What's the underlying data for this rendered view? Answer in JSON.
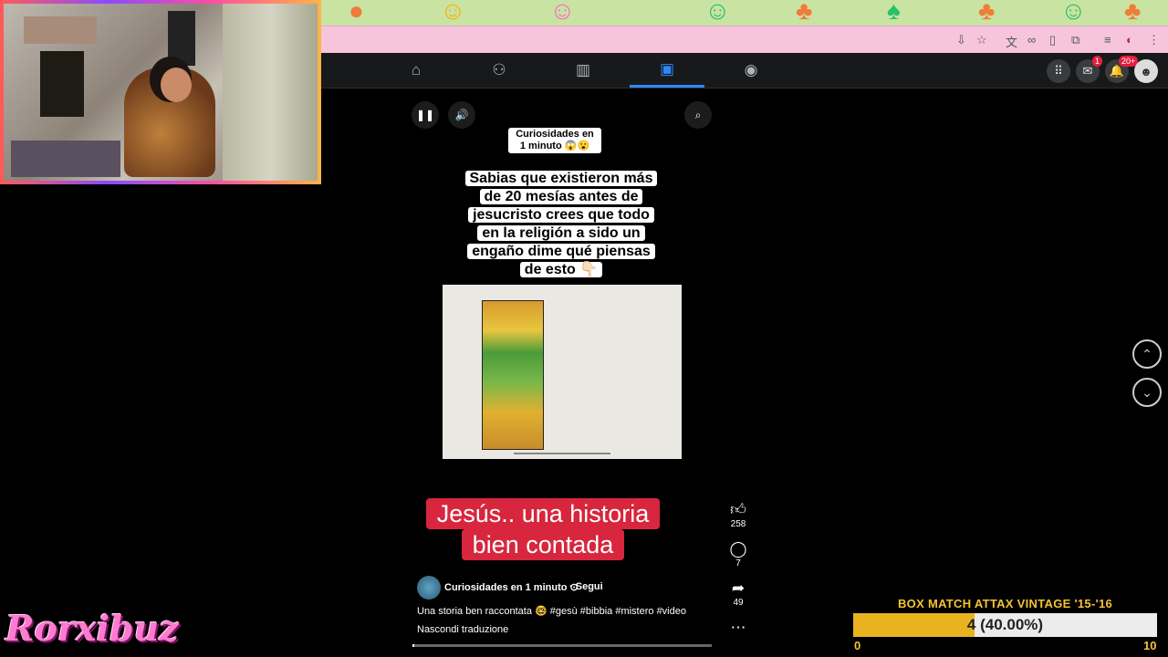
{
  "browser": {
    "toolbar_icons": [
      "install-icon",
      "star-icon",
      "translate-icon",
      "link-icon",
      "reader-icon",
      "extension-icon",
      "tab-search-icon",
      "profile-icon",
      "menu-icon"
    ]
  },
  "facebook_nav": {
    "tabs": [
      {
        "icon": "home-icon",
        "glyph": "⌂",
        "active": false
      },
      {
        "icon": "friends-icon",
        "glyph": "👥",
        "active": false
      },
      {
        "icon": "dashboard-icon",
        "glyph": "▥",
        "active": false
      },
      {
        "icon": "reels-icon",
        "glyph": "▣",
        "active": true
      },
      {
        "icon": "groups-icon",
        "glyph": "◉",
        "active": false
      }
    ],
    "messenger_badge": "1",
    "notifications_badge": "20+"
  },
  "reel": {
    "channel_chip": "Curiosidades en 1 minuto 😱😮",
    "overlay_text": "Sabias que existieron más de 20 mesías antes de jesucristo crees que todo en la religión a sido un engaño dime qué piensas de esto 👇🏻",
    "red_caption_line1": "Jesús.. una historia",
    "red_caption_line2": "bien contada",
    "author": "Curiosidades en 1 minuto ⊙",
    "follow": "Segui",
    "description": "Una storia ben raccontata 🤓 #gesù #bibbia #mistero #video",
    "hide_translation": "Nascondi traduzione",
    "likes": "258",
    "comments": "7",
    "shares": "49",
    "progress": 0.005
  },
  "overlay": {
    "title": "BOX MATCH ATTAX VINTAGE '15-'16",
    "value_label": "4 (40.00%)",
    "fraction": 0.4,
    "min": "0",
    "max": "10",
    "colors": {
      "bar": "#e9b320",
      "track": "#ececec",
      "text": "#f4c430"
    }
  },
  "streamer_logo": "Rorxibuz"
}
